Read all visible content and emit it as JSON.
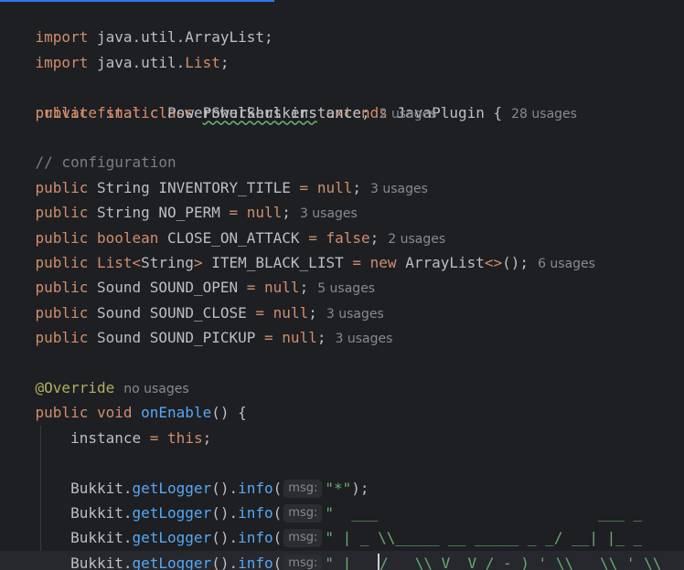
{
  "code": {
    "l1_kw": "import",
    "l1_rest": " java.util.ArrayList;",
    "l2_kw": "import",
    "l2_rest": " java.util.",
    "l2_list": "List",
    "l2_semi": ";",
    "l4_public": "public",
    "l4_final": "final",
    "l4_class": "class",
    "l4_name": "PowerShulkers",
    "l4_extends": "extends",
    "l4_parent": "JavaPlugin",
    "l4_brace": " {",
    "l4_hint": "28 usages",
    "l5_private": "private",
    "l5_static": "static",
    "l5_type": "PowerShulkers",
    "l5_field": "instance;",
    "l5_hint": "2 usages",
    "l7_comment": "// configuration",
    "f1_public": "public",
    "f1_type": "String",
    "f1_name": "INVENTORY_TITLE",
    "f1_eq": "=",
    "f1_val": "null",
    "f1_semi": ";",
    "f1_hint": "3 usages",
    "f2_public": "public",
    "f2_type": "String",
    "f2_name": "NO_PERM",
    "f2_eq": "=",
    "f2_val": "null",
    "f2_semi": ";",
    "f2_hint": "3 usages",
    "f3_public": "public",
    "f3_type": "boolean",
    "f3_name": "CLOSE_ON_ATTACK",
    "f3_eq": "=",
    "f3_val": "false",
    "f3_semi": ";",
    "f3_hint": "2 usages",
    "f4_public": "public",
    "f4_type": "List",
    "f4_lt": "<",
    "f4_generic": "String",
    "f4_gt": ">",
    "f4_name": "ITEM_BLACK_LIST",
    "f4_eq": "=",
    "f4_new": "new",
    "f4_ctor": "ArrayList",
    "f4_diamond": "<>",
    "f4_end": "();",
    "f4_hint": "6 usages",
    "f5_public": "public",
    "f5_type": "Sound",
    "f5_name": "SOUND_OPEN",
    "f5_eq": "=",
    "f5_val": "null",
    "f5_semi": ";",
    "f5_hint": "5 usages",
    "f6_public": "public",
    "f6_type": "Sound",
    "f6_name": "SOUND_CLOSE",
    "f6_eq": "=",
    "f6_val": "null",
    "f6_semi": ";",
    "f6_hint": "3 usages",
    "f7_public": "public",
    "f7_type": "Sound",
    "f7_name": "SOUND_PICKUP",
    "f7_eq": "=",
    "f7_val": "null",
    "f7_semi": ";",
    "f7_hint": "3 usages",
    "ann": "@Override",
    "ann_hint": "no usages",
    "m_public": "public",
    "m_void": "void",
    "m_name": "onEnable",
    "m_sig": "() {",
    "i_field": "instance",
    "i_eq": "=",
    "i_this": "this",
    "i_semi": ";",
    "log_prefix": "Bukkit.",
    "log_call": "getLogger",
    "log_mid": "().",
    "log_info": "info",
    "log_paren": "(",
    "param_hint": "msg:",
    "log1_str": "\"*\"",
    "log1_end": ");",
    "log2_str": "\"  ___                         ___ _",
    "log3_str": "\" | _ \\\\_____ __ _____ _ _/ __| |_ _",
    "log4_str_a": "\" |  _",
    "log4_str_b": "/ _ \\\\ V  V / -_) '_\\\\__ \\\\ ' \\\\"
  }
}
